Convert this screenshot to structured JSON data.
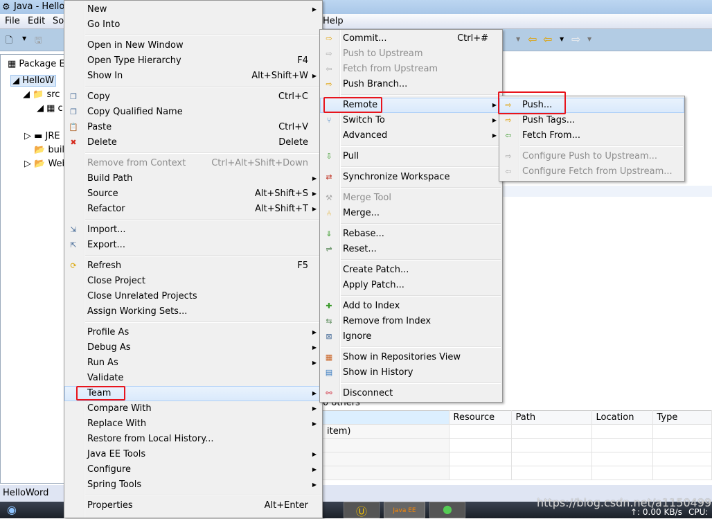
{
  "window": {
    "title": "Java - HelloW"
  },
  "menubar": [
    "File",
    "Edit",
    "So",
    "Help"
  ],
  "package_explorer": {
    "title": "Package Ex",
    "tree": [
      "HelloW",
      "src",
      "c",
      "JRE",
      "buil",
      "Web"
    ]
  },
  "problems": {
    "summary": "0 others",
    "columns": [
      "",
      "Resource",
      "Path",
      "Location",
      "Type"
    ],
    "first_cell": "item)"
  },
  "status": {
    "text": "HelloWord"
  },
  "taskbar": {
    "net": "↑: 0.00 KB/s",
    "cpu": "CPU:",
    "javaee": "Java EE"
  },
  "watermark": "https://blog.csdn.net/a1150499208",
  "context_menu": [
    {
      "label": "New",
      "arrow": true
    },
    {
      "label": "Go Into"
    },
    {
      "sep": true
    },
    {
      "label": "Open in New Window"
    },
    {
      "label": "Open Type Hierarchy",
      "shortcut": "F4"
    },
    {
      "label": "Show In",
      "shortcut": "Alt+Shift+W",
      "arrow": true
    },
    {
      "sep": true
    },
    {
      "label": "Copy",
      "shortcut": "Ctrl+C",
      "icon": "copy-icon",
      "g": "❐"
    },
    {
      "label": "Copy Qualified Name",
      "icon": "copy-qualified-icon",
      "g": "❐"
    },
    {
      "label": "Paste",
      "shortcut": "Ctrl+V",
      "icon": "paste-icon",
      "g": "📋"
    },
    {
      "label": "Delete",
      "shortcut": "Delete",
      "icon": "delete-icon",
      "g": "✖",
      "c": "#d52b1e"
    },
    {
      "sep": true
    },
    {
      "label": "Remove from Context",
      "shortcut": "Ctrl+Alt+Shift+Down",
      "disabled": true
    },
    {
      "label": "Build Path",
      "arrow": true
    },
    {
      "label": "Source",
      "shortcut": "Alt+Shift+S",
      "arrow": true
    },
    {
      "label": "Refactor",
      "shortcut": "Alt+Shift+T",
      "arrow": true
    },
    {
      "sep": true
    },
    {
      "label": "Import...",
      "icon": "import-icon",
      "g": "⇲"
    },
    {
      "label": "Export...",
      "icon": "export-icon",
      "g": "⇱"
    },
    {
      "sep": true
    },
    {
      "label": "Refresh",
      "shortcut": "F5",
      "icon": "refresh-icon",
      "g": "⟳",
      "c": "#d9a400"
    },
    {
      "label": "Close Project"
    },
    {
      "label": "Close Unrelated Projects"
    },
    {
      "label": "Assign Working Sets..."
    },
    {
      "sep": true
    },
    {
      "label": "Profile As",
      "arrow": true
    },
    {
      "label": "Debug As",
      "arrow": true
    },
    {
      "label": "Run As",
      "arrow": true
    },
    {
      "label": "Validate"
    },
    {
      "label": "Team",
      "arrow": true,
      "highlight": true
    },
    {
      "label": "Compare With",
      "arrow": true
    },
    {
      "label": "Replace With",
      "arrow": true
    },
    {
      "label": "Restore from Local History..."
    },
    {
      "label": "Java EE Tools",
      "arrow": true
    },
    {
      "label": "Configure",
      "arrow": true
    },
    {
      "label": "Spring Tools",
      "arrow": true
    },
    {
      "sep": true
    },
    {
      "label": "Properties",
      "shortcut": "Alt+Enter"
    }
  ],
  "team_menu": [
    {
      "label": "Commit...",
      "shortcut": "Ctrl+#",
      "icon": "commit-icon",
      "g": "⇨",
      "c": "#e0a000"
    },
    {
      "label": "Push to Upstream",
      "disabled": true,
      "icon": "push-upstream-icon",
      "g": "⇨"
    },
    {
      "label": "Fetch from Upstream",
      "disabled": true,
      "icon": "fetch-upstream-icon",
      "g": "⇦"
    },
    {
      "label": "Push Branch...",
      "icon": "push-branch-icon",
      "g": "⇨",
      "c": "#e0a000"
    },
    {
      "sep": true
    },
    {
      "label": "Remote",
      "arrow": true,
      "highlight": true
    },
    {
      "label": "Switch To",
      "arrow": true,
      "icon": "switch-icon",
      "g": "⑂",
      "c": "#3a7bbf"
    },
    {
      "label": "Advanced",
      "arrow": true
    },
    {
      "sep": true
    },
    {
      "label": "Pull",
      "icon": "pull-icon",
      "g": "⇩",
      "c": "#3a9a2a"
    },
    {
      "sep": true
    },
    {
      "label": "Synchronize Workspace",
      "icon": "synchronize-icon",
      "g": "⇄",
      "c": "#c03020"
    },
    {
      "sep": true
    },
    {
      "label": "Merge Tool",
      "disabled": true,
      "icon": "merge-tool-icon",
      "g": "⚒"
    },
    {
      "label": "Merge...",
      "icon": "merge-icon",
      "g": "⑃",
      "c": "#e0a000"
    },
    {
      "sep": true
    },
    {
      "label": "Rebase...",
      "icon": "rebase-icon",
      "g": "⇓",
      "c": "#3a9a2a"
    },
    {
      "label": "Reset...",
      "icon": "reset-icon",
      "g": "⇌",
      "c": "#5a8a5a"
    },
    {
      "sep": true
    },
    {
      "label": "Create Patch..."
    },
    {
      "label": "Apply Patch..."
    },
    {
      "sep": true
    },
    {
      "label": "Add to Index",
      "icon": "add-index-icon",
      "g": "✚",
      "c": "#3a9a2a"
    },
    {
      "label": "Remove from Index",
      "icon": "remove-index-icon",
      "g": "⇆",
      "c": "#5a8a5a"
    },
    {
      "label": "Ignore",
      "icon": "ignore-icon",
      "g": "⊠"
    },
    {
      "sep": true
    },
    {
      "label": "Show in Repositories View",
      "icon": "git-repo-icon",
      "g": "▦",
      "c": "#c86020"
    },
    {
      "label": "Show in History",
      "icon": "history-icon",
      "g": "▤",
      "c": "#3a7bbf"
    },
    {
      "sep": true
    },
    {
      "label": "Disconnect",
      "icon": "disconnect-icon",
      "g": "⚯",
      "c": "#d03040"
    }
  ],
  "remote_menu": [
    {
      "label": "Push...",
      "icon": "push-icon",
      "g": "⇨",
      "c": "#e0a000",
      "highlight": true
    },
    {
      "label": "Push Tags...",
      "icon": "push-tags-icon",
      "g": "⇨",
      "c": "#e0a000"
    },
    {
      "label": "Fetch From...",
      "icon": "fetch-icon",
      "g": "⇦",
      "c": "#3a9a2a"
    },
    {
      "sep": true
    },
    {
      "label": "Configure Push to Upstream...",
      "disabled": true,
      "icon": "configure-push-icon",
      "g": "⇨"
    },
    {
      "label": "Configure Fetch from Upstream...",
      "disabled": true,
      "icon": "configure-fetch-icon",
      "g": "⇦"
    }
  ]
}
